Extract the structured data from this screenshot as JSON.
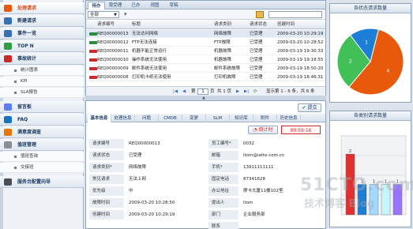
{
  "sidebar": {
    "items": [
      {
        "label": "处理请求",
        "active": true,
        "color": "#e8590c"
      },
      {
        "label": "新建请求",
        "color": "#3b6fb6"
      },
      {
        "label": "事件一览",
        "color": "#3b6fb6"
      },
      {
        "label": "TOP N",
        "color": "#2f9e44"
      },
      {
        "label": "事故统计",
        "color": "#c92a2a"
      }
    ],
    "stats_subs": [
      "统计图表",
      "KPI",
      "SLA报告"
    ],
    "items2": [
      {
        "label": "留言板",
        "color": "#5c7cfa"
      },
      {
        "label": "FAQ",
        "color": "#1971c2"
      },
      {
        "label": "满意度调查",
        "color": "#e67700"
      },
      {
        "label": "值班管理",
        "color": "#868e96"
      }
    ],
    "duty_subs": [
      "值班查询",
      "交接班"
    ],
    "items3": [
      {
        "label": "服务台配置向导",
        "color": "#495057"
      }
    ]
  },
  "grid": {
    "tabs": [
      "待办",
      "我受理",
      "已办",
      "视图",
      "草稿"
    ],
    "filter_select": "全部",
    "columns": [
      "请求编号",
      "标题",
      "请求类别",
      "请求状态",
      "创建时间"
    ],
    "rows": [
      {
        "id": "REQ00000013",
        "title": "无法访问网络",
        "category": "网络故障",
        "status": "已受理",
        "time": "2009-03-20 10:29:19",
        "pri": "#2b8a3e",
        "selected": true
      },
      {
        "id": "REQ00000012",
        "title": "FTP无法连接",
        "category": "FTP故障",
        "status": "已受理",
        "time": "2009-03-20 10:28:52",
        "pri": "#2b8a3e"
      },
      {
        "id": "REQ00000011",
        "title": "机器不能正常运行",
        "category": "机器故障",
        "status": "已受理",
        "time": "2009-03-19 19:30:33",
        "pri": "#c92a2a"
      },
      {
        "id": "REQ00000010",
        "title": "操作系统无法使用",
        "category": "机器故障",
        "status": "已受理",
        "time": "2009-03-19 19:18:55",
        "pri": "#c92a2a"
      },
      {
        "id": "REQ00000009",
        "title": "邮件系统无法使用",
        "category": "邮件系统故障",
        "status": "已受理",
        "time": "2009-03-19 18:50:20",
        "pri": "#c92a2a"
      },
      {
        "id": "REQ00000008",
        "title": "打印机卡纸无法使用",
        "category": "打印机故障",
        "status": "已受理",
        "time": "2009-03-19 18:46:31",
        "pri": "#c92a2a"
      }
    ],
    "pager": {
      "page_prefix": "第",
      "page": "1",
      "page_suffix": "页",
      "total_pages": "共 1 页",
      "summary": "显示第 1 - 6 条，共 6 条"
    }
  },
  "detail": {
    "submit_label": "提交",
    "dtabs": [
      "基本信息",
      "处理信息",
      "问题",
      "CMDB",
      "变更",
      "SLM",
      "知识库",
      "附件",
      "历史信息"
    ],
    "timer_label": "倒计时",
    "timer_value": "00:59:16",
    "left_fields": [
      {
        "label": "请求编号",
        "value": "REQ00000013"
      },
      {
        "label": "请求状态",
        "value": "已受理"
      },
      {
        "label": "请求类别*",
        "value": "网络故障"
      },
      {
        "label": "常见请求",
        "value": "无法上网"
      },
      {
        "label": "优先级",
        "value": "中"
      },
      {
        "label": "故障时间",
        "value": "2009-03-20 10:28:50"
      },
      {
        "label": "创建时间",
        "value": "2009-03-20 10:29:19"
      }
    ],
    "right_fields": [
      {
        "label": "员工编号*",
        "value": "0032"
      },
      {
        "label": "邮箱",
        "value": "itom@iatte.com.cn"
      },
      {
        "label": "手机*",
        "value": "13911111111"
      },
      {
        "label": "固定电话",
        "value": "87341628"
      },
      {
        "label": "办公地址",
        "value": "摩卡大厦11楼102室"
      },
      {
        "label": "提出人",
        "value": "itom"
      },
      {
        "label": "部门",
        "value": "企业服务部"
      },
      {
        "label": "联系",
        "value": ""
      }
    ]
  },
  "pie_panel": {
    "title": "各状态请求数量",
    "chart_data": {
      "type": "pie",
      "slices": [
        {
          "label": "4",
          "value": 4,
          "color": "#e8590c"
        },
        {
          "label": "2",
          "value": 2,
          "color": "#40c057"
        },
        {
          "label": "1",
          "value": 1,
          "color": "#1c7ed6"
        }
      ]
    }
  },
  "bar_panel": {
    "title": "各类别请求数量",
    "chart_data": {
      "type": "bar",
      "values": [
        2,
        1,
        1,
        1,
        1
      ],
      "colors": [
        "#e03131",
        "#1c7ed6",
        "#a5d8ff",
        "#c5f6fa",
        "#9775fa"
      ],
      "data_labels": [
        "2",
        "1",
        "1",
        "1",
        "1"
      ],
      "ylim": [
        0,
        2.6
      ]
    }
  },
  "watermark": {
    "line1": "51CTO.com",
    "line2": "技术博客 Blog"
  }
}
